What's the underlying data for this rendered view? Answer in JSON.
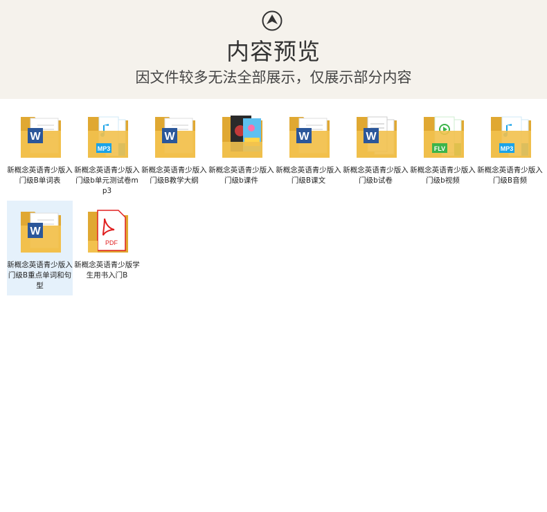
{
  "header": {
    "title": "内容预览",
    "subtitle": "因文件较多无法全部展示，仅展示部分内容"
  },
  "files": [
    {
      "name": "新概念英语青少版入门级B单词表",
      "icon": "word-folder-icon"
    },
    {
      "name": "新概念英语青少版入门级b单元测试卷mp3",
      "icon": "mp3-folder-icon"
    },
    {
      "name": "新概念英语青少版入门级B教学大纲",
      "icon": "word-folder-icon"
    },
    {
      "name": "新概念英语青少版入门级b课件",
      "icon": "image-folder-icon"
    },
    {
      "name": "新概念英语青少版入门级B课文",
      "icon": "word-folder-icon"
    },
    {
      "name": "新概念英语青少版入门级b试卷",
      "icon": "document-folder-icon"
    },
    {
      "name": "新概念英语青少版入门级b视频",
      "icon": "flv-folder-icon"
    },
    {
      "name": "新概念英语青少版入门级B音频",
      "icon": "mp3-folder-icon"
    },
    {
      "name": "新概念英语青少版入门级B重点单词和句型",
      "icon": "word-folder-icon",
      "selected": true
    },
    {
      "name": "新概念英语青少版学生用书入门B",
      "icon": "pdf-folder-icon"
    }
  ],
  "badges": {
    "word": "W",
    "mp3": "MP3",
    "flv": "FLV",
    "pdf": "PDF"
  },
  "colors": {
    "folder": "#f2c14e",
    "folder_dark": "#e0a832",
    "word": "#2b579a",
    "mp3": "#1aa3e8",
    "flv": "#3cb44a",
    "pdf": "#e02020",
    "header_bg": "#f5f2ec",
    "selected_bg": "#e5f1fb"
  }
}
